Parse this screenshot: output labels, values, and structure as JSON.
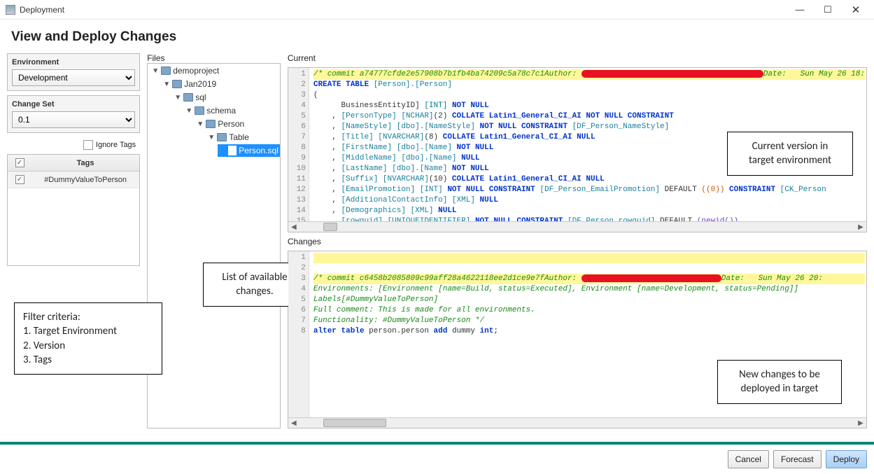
{
  "window": {
    "title": "Deployment"
  },
  "heading": "View and Deploy Changes",
  "left": {
    "environment_label": "Environment",
    "environment_value": "Development",
    "changeset_label": "Change Set",
    "changeset_value": "0.1",
    "ignore_tags_label": "Ignore Tags",
    "tags_header_check": "✓",
    "tags_header_label": "Tags",
    "tag_row_check": "✓",
    "tag_row_value": "#DummyValueToPerson"
  },
  "files": {
    "label": "Files",
    "root": "demoproject",
    "n1": "Jan2019",
    "n2": "sql",
    "n3": "schema",
    "n4": "Person",
    "n5": "Table",
    "file": "Person.sql"
  },
  "current": {
    "label": "Current",
    "commit_prefix": "/* commit a74777cfde2e57908b7b1fb4ba74209c5a78c7c1Author: ",
    "commit_date": "Date:   Sun May 26 18:",
    "l2a": "CREATE TABLE",
    "l2b": " [Person].[Person]",
    "l3": "(",
    "l4a": "      BusinessEntityID] ",
    "l4b": "[INT]",
    "l4c": " NOT NULL",
    "l5a": "    , ",
    "l5b": "[PersonType] [NCHAR]",
    "l5c": "(2)",
    "l5d": " COLLATE Latin1_General_CI_AI",
    "l5e": " NOT NULL CONSTRAINT",
    "l6a": "    , ",
    "l6b": "[NameStyle] [dbo].[NameStyle]",
    "l6c": " NOT NULL CONSTRAINT",
    "l6d": " [DF_Person_NameStyle]",
    "l7a": "    , ",
    "l7b": "[Title] [NVARCHAR]",
    "l7c": "(8)",
    "l7d": " COLLATE Latin1_General_CI_AI",
    "l7e": " NULL",
    "l8a": "    , ",
    "l8b": "[FirstName] [dbo].[Name]",
    "l8c": " NOT NULL",
    "l9a": "    , ",
    "l9b": "[MiddleName] [dbo].[Name]",
    "l9c": " NULL",
    "l10a": "    , ",
    "l10b": "[LastName] [dbo].[Name]",
    "l10c": " NOT NULL",
    "l11a": "    , ",
    "l11b": "[Suffix] [NVARCHAR]",
    "l11c": "(10)",
    "l11d": " COLLATE Latin1_General_CI_AI",
    "l11e": " NULL",
    "l12a": "    , ",
    "l12b": "[EmailPromotion] [INT]",
    "l12c": " NOT NULL CONSTRAINT",
    "l12d": " [DF_Person_EmailPromotion]",
    "l12e": " DEFAULT ",
    "l12f": "((0))",
    "l12g": " CONSTRAINT",
    "l12h": " [CK_Person",
    "l13a": "    , ",
    "l13b": "[AdditionalContactInfo] [XML]",
    "l13c": " NULL",
    "l14a": "    , ",
    "l14b": "[Demographics] [XML]",
    "l14c": " NULL",
    "l15a": "    , ",
    "l15b": "[rowguid] [UNIQUEIDENTIFIER]",
    "l15c": " NOT NULL CONSTRAINT",
    "l15d": " [DF_Person_rowguid]",
    "l15e": " DEFAULT ",
    "l15f": "(newid())"
  },
  "changes": {
    "label": "Changes",
    "l1": " ",
    "l2": " ",
    "l3_prefix": "/* commit c6458b2085809c99aff28a4622118ee2d1ce9e7fAuthor: ",
    "l3_date": "Date:   Sun May 26 20:",
    "l4": "Environments: [Environment [name=Build, status=Executed], Environment [name=Development, status=Pending]]",
    "l5": "Labels[#DummyValueToPerson]",
    "l6": "Full comment: This is made for all environments.",
    "l7": "Functionality: #DummyValueToPerson */",
    "l8a": "alter table",
    "l8b": " person.person ",
    "l8c": "add",
    "l8d": " dummy ",
    "l8e": "int",
    "l8f": ";"
  },
  "callouts": {
    "files": "List of available changes.",
    "filter_title": "Filter criteria:",
    "filter_1": "1.   Target Environment",
    "filter_2": "2.   Version",
    "filter_3": "3.   Tags",
    "current_1": "Current version in",
    "current_2": "target environment",
    "changes_1": "New changes to be",
    "changes_2": "deployed in target"
  },
  "footer": {
    "cancel": "Cancel",
    "forecast": "Forecast",
    "deploy": "Deploy"
  }
}
